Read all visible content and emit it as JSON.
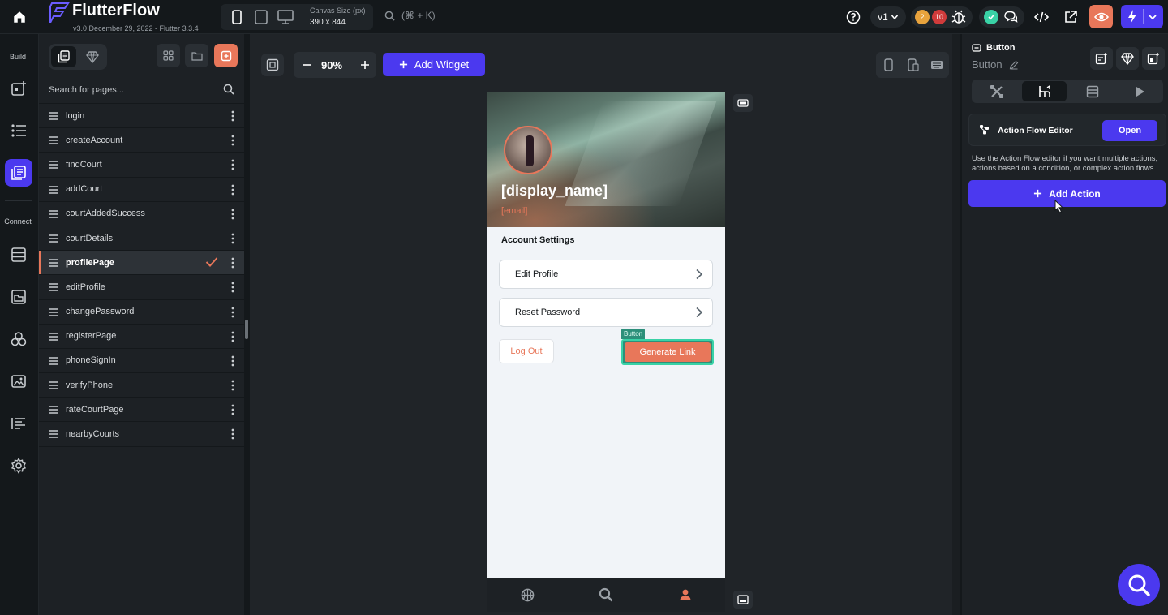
{
  "app": {
    "name": "FlutterFlow",
    "version": "v3.0 December 29, 2022 - Flutter 3.3.4"
  },
  "toolbar": {
    "canvas_size_label": "Canvas Size (px)",
    "canvas_size_value": "390 x 844",
    "command_shortcut": "(⌘ + K)",
    "version": "v1",
    "badge_warnings": "2",
    "badge_errors": "10"
  },
  "rail": {
    "build_label": "Build",
    "connect_label": "Connect"
  },
  "pages_panel": {
    "search_placeholder": "Search for pages...",
    "active_page": "profilePage",
    "pages": [
      "login",
      "createAccount",
      "findCourt",
      "addCourt",
      "courtAddedSuccess",
      "courtDetails",
      "profilePage",
      "editProfile",
      "changePassword",
      "registerPage",
      "phoneSignIn",
      "verifyPhone",
      "rateCourtPage",
      "nearbyCourts"
    ]
  },
  "canvas": {
    "zoom": "90%",
    "add_widget_label": "Add Widget"
  },
  "phone": {
    "display_name": "[display_name]",
    "email": "[email]",
    "section_title": "Account Settings",
    "cards": [
      {
        "label": "Edit Profile"
      },
      {
        "label": "Reset Password"
      }
    ],
    "logout_label": "Log Out",
    "selected_widget_tag": "Button",
    "generate_label": "Generate Link"
  },
  "properties": {
    "widget_type": "Button",
    "widget_name": "Button",
    "action_flow_title": "Action Flow Editor",
    "open_label": "Open",
    "help_text": "Use the Action Flow editor if you want multiple actions, actions based on a condition, or complex action flows.",
    "add_action_label": "Add Action"
  },
  "colors": {
    "primary": "#4b39ef",
    "accent": "#e8775a",
    "selection": "#39d2a6"
  }
}
